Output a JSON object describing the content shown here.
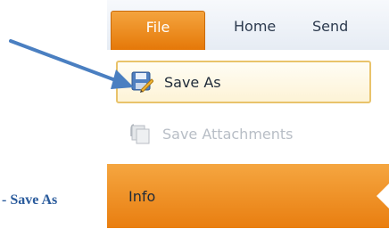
{
  "tabs": {
    "file": "File",
    "home": "Home",
    "send": "Send"
  },
  "menu": {
    "save_as": "Save As",
    "save_attachments": "Save Attachments"
  },
  "nav": {
    "info": "Info"
  },
  "caption": "- Save As",
  "icons": {
    "save_as": "save-as-icon",
    "save_attachments": "save-attachments-icon",
    "pointer": "arrow-icon"
  },
  "colors": {
    "accent_orange": "#e97e10",
    "highlight_border": "#e9c36b",
    "caption_blue": "#2a5b9c",
    "arrow_blue": "#4a7fc1"
  }
}
